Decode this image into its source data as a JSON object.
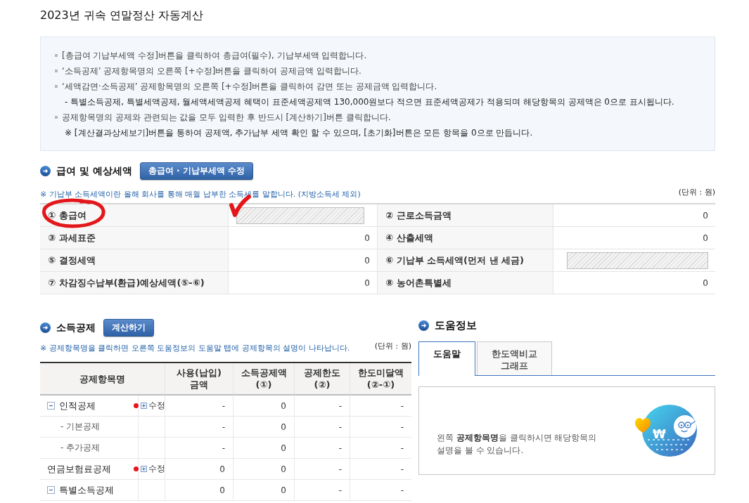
{
  "page": {
    "title": "2023년 귀속 연말정산 자동계산"
  },
  "instructions": [
    {
      "text": "[총급여 기납부세액 수정]버튼을 클릭하여 총급여(필수), 기납부세액 입력합니다."
    },
    {
      "text": "‘소득공제’ 공제항목명의 오른쪽 [+수정]버튼을 클릭하여 공제금액 입력합니다."
    },
    {
      "text": "‘세액감면·소득공제’ 공제항목명의 오른쪽 [+수정]버튼을 클릭하여 감면 또는 공제금액 입력합니다.",
      "notes": [
        "- 특별소득공제, 특별세액공제, 월세액세액공제 혜택이 표준세액공제액 130,000원보다 적으면 표준세액공제가 적용되며 해당항목의 공제액은 0으로 표시됩니다."
      ]
    },
    {
      "text": "공제항목명의 공제와 관련되는 값을 모두 입력한 후 반드시 [계산하기]버튼 클릭합니다.",
      "notes": [
        "※ [계산결과상세보기]버튼을 통하여 공제액, 추가납부 세액 확인 할 수 있으며, [초기화]버튼은 모든 항목을 0으로 만듭니다."
      ]
    }
  ],
  "salary_section": {
    "heading": "급여 및 예상세액",
    "button": "총급여 · 기납부세액 수정",
    "note": "※ 기납부 소득세액이란 올해 회사를 통해 매월 납부한 소득세를 말합니다. (지방소득세 제외)",
    "unit": "(단위 : 원)",
    "cells": [
      {
        "label": "① 총급여",
        "kind": "input",
        "disabled": true
      },
      {
        "label": "② 근로소득금액",
        "kind": "value",
        "value": "0"
      },
      {
        "label": "③ 과세표준",
        "kind": "value",
        "value": "0"
      },
      {
        "label": "④ 산출세액",
        "kind": "value",
        "value": "0"
      },
      {
        "label": "⑤ 결정세액",
        "kind": "value",
        "value": "0"
      },
      {
        "label": "⑥ 기납부 소득세액(먼저 낸 세금)",
        "kind": "input",
        "disabled": true
      },
      {
        "label": "⑦ 차감징수납부(환급)예상세액(⑤-⑥)",
        "kind": "value",
        "value": "0"
      },
      {
        "label": "⑧ 농어촌특별세",
        "kind": "value",
        "value": "0"
      }
    ]
  },
  "deduction_section": {
    "heading": "소득공제",
    "button": "계산하기",
    "note": "※ 공제항목명을 클릭하면 오른쪽 도움정보의 도움말 탭에 공제항목의 설명이 나타납니다.",
    "unit": "(단위 : 원)",
    "columns": [
      "공제항목명",
      "사용(납입)\n금액",
      "소득공제액\n(①)",
      "공제한도\n(②)",
      "한도미달액\n(②-①)"
    ],
    "rows": [
      {
        "name": "인적공제",
        "expanded": true,
        "required": true,
        "edit": "수정",
        "values": [
          "-",
          "0",
          "-",
          "-"
        ],
        "children": [
          {
            "name": "- 기본공제",
            "values": [
              "-",
              "0",
              "-",
              "-"
            ]
          },
          {
            "name": "- 추가공제",
            "values": [
              "-",
              "0",
              "-",
              "-"
            ]
          }
        ]
      },
      {
        "name": "연금보험료공제",
        "required": true,
        "edit": "수정",
        "values": [
          "0",
          "0",
          "-",
          "-"
        ]
      },
      {
        "name": "특별소득공제",
        "expanded": true,
        "values": [
          "0",
          "0",
          "-",
          "-"
        ]
      }
    ]
  },
  "help": {
    "heading": "도움정보",
    "tabs": [
      {
        "label": "도움말",
        "selected": true
      },
      {
        "label": "한도액비교\n그래프",
        "selected": false
      }
    ],
    "message": "왼쪽 **공제항목명**을 클릭하시면 해당항목의\n설명을 볼 수 있습니다.",
    "illustration_symbol": "₩"
  }
}
